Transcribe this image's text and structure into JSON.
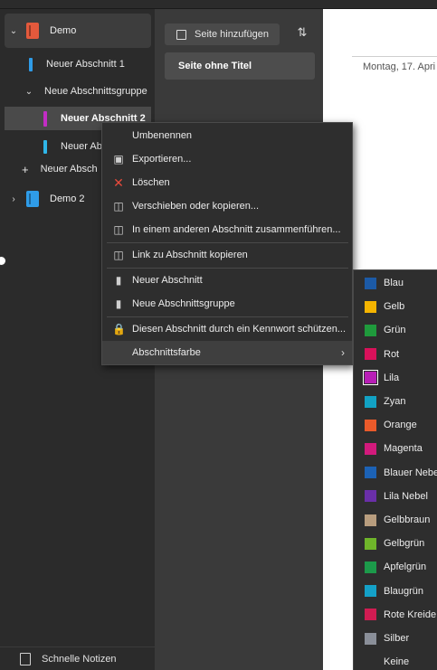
{
  "sidebar": {
    "notebooks": [
      {
        "label": "Demo",
        "color": "#e3593c"
      },
      {
        "label": "Demo 2",
        "color": "#2f9ce8"
      }
    ],
    "sections": [
      {
        "label": "Neuer Abschnitt 1",
        "color": "#2f9ce8"
      },
      {
        "label": "Neue Abschnittsgruppe"
      },
      {
        "label": "Neuer Abschnitt 2",
        "color": "#c22dc4"
      },
      {
        "label": "Neuer Ab",
        "color": "#2fb6e8"
      },
      {
        "label": "Neuer Absch"
      }
    ],
    "footer": "Schnelle Notizen"
  },
  "pages": {
    "add_label": "Seite hinzufügen",
    "items": [
      {
        "label": "Seite ohne Titel"
      }
    ]
  },
  "canvas": {
    "date": "Montag, 17. Apri"
  },
  "context_menu": {
    "items": [
      {
        "label": "Umbenennen",
        "icon": "rename-icon"
      },
      {
        "label": "Exportieren...",
        "icon": "export-icon"
      },
      {
        "label": "Löschen",
        "icon": "delete-icon"
      },
      {
        "label": "Verschieben oder kopieren...",
        "icon": "move-copy-icon"
      },
      {
        "label": "In einem anderen Abschnitt zusammenführen...",
        "icon": "merge-icon"
      },
      {
        "label": "Link zu Abschnitt kopieren",
        "icon": "link-icon"
      },
      {
        "label": "Neuer Abschnitt",
        "icon": "new-section-icon"
      },
      {
        "label": "Neue Abschnittsgruppe",
        "icon": "new-group-icon"
      },
      {
        "label": "Diesen Abschnitt durch ein Kennwort schützen...",
        "icon": "lock-icon"
      },
      {
        "label": "Abschnittsfarbe",
        "icon": ""
      }
    ]
  },
  "color_menu": {
    "items": [
      {
        "label": "Blau",
        "color": "#1c5aa6"
      },
      {
        "label": "Gelb",
        "color": "#f5b400"
      },
      {
        "label": "Grün",
        "color": "#1f9a3c"
      },
      {
        "label": "Rot",
        "color": "#d8115a"
      },
      {
        "label": "Lila",
        "color": "#b81fb6"
      },
      {
        "label": "Zyan",
        "color": "#12a2c4"
      },
      {
        "label": "Orange",
        "color": "#ea5a2a"
      },
      {
        "label": "Magenta",
        "color": "#d21a7c"
      },
      {
        "label": "Blauer Nebel",
        "color": "#1c62b5"
      },
      {
        "label": "Lila Nebel",
        "color": "#6a2fa8"
      },
      {
        "label": "Gelbbraun",
        "color": "#b89d7e"
      },
      {
        "label": "Gelbgrün",
        "color": "#6fb52a"
      },
      {
        "label": "Apfelgrün",
        "color": "#1c9a4a"
      },
      {
        "label": "Blaugrün",
        "color": "#14a1c8"
      },
      {
        "label": "Rote Kreide",
        "color": "#d01c52"
      },
      {
        "label": "Silber",
        "color": "#8a8f99"
      },
      {
        "label": "Keine",
        "color": ""
      }
    ]
  }
}
